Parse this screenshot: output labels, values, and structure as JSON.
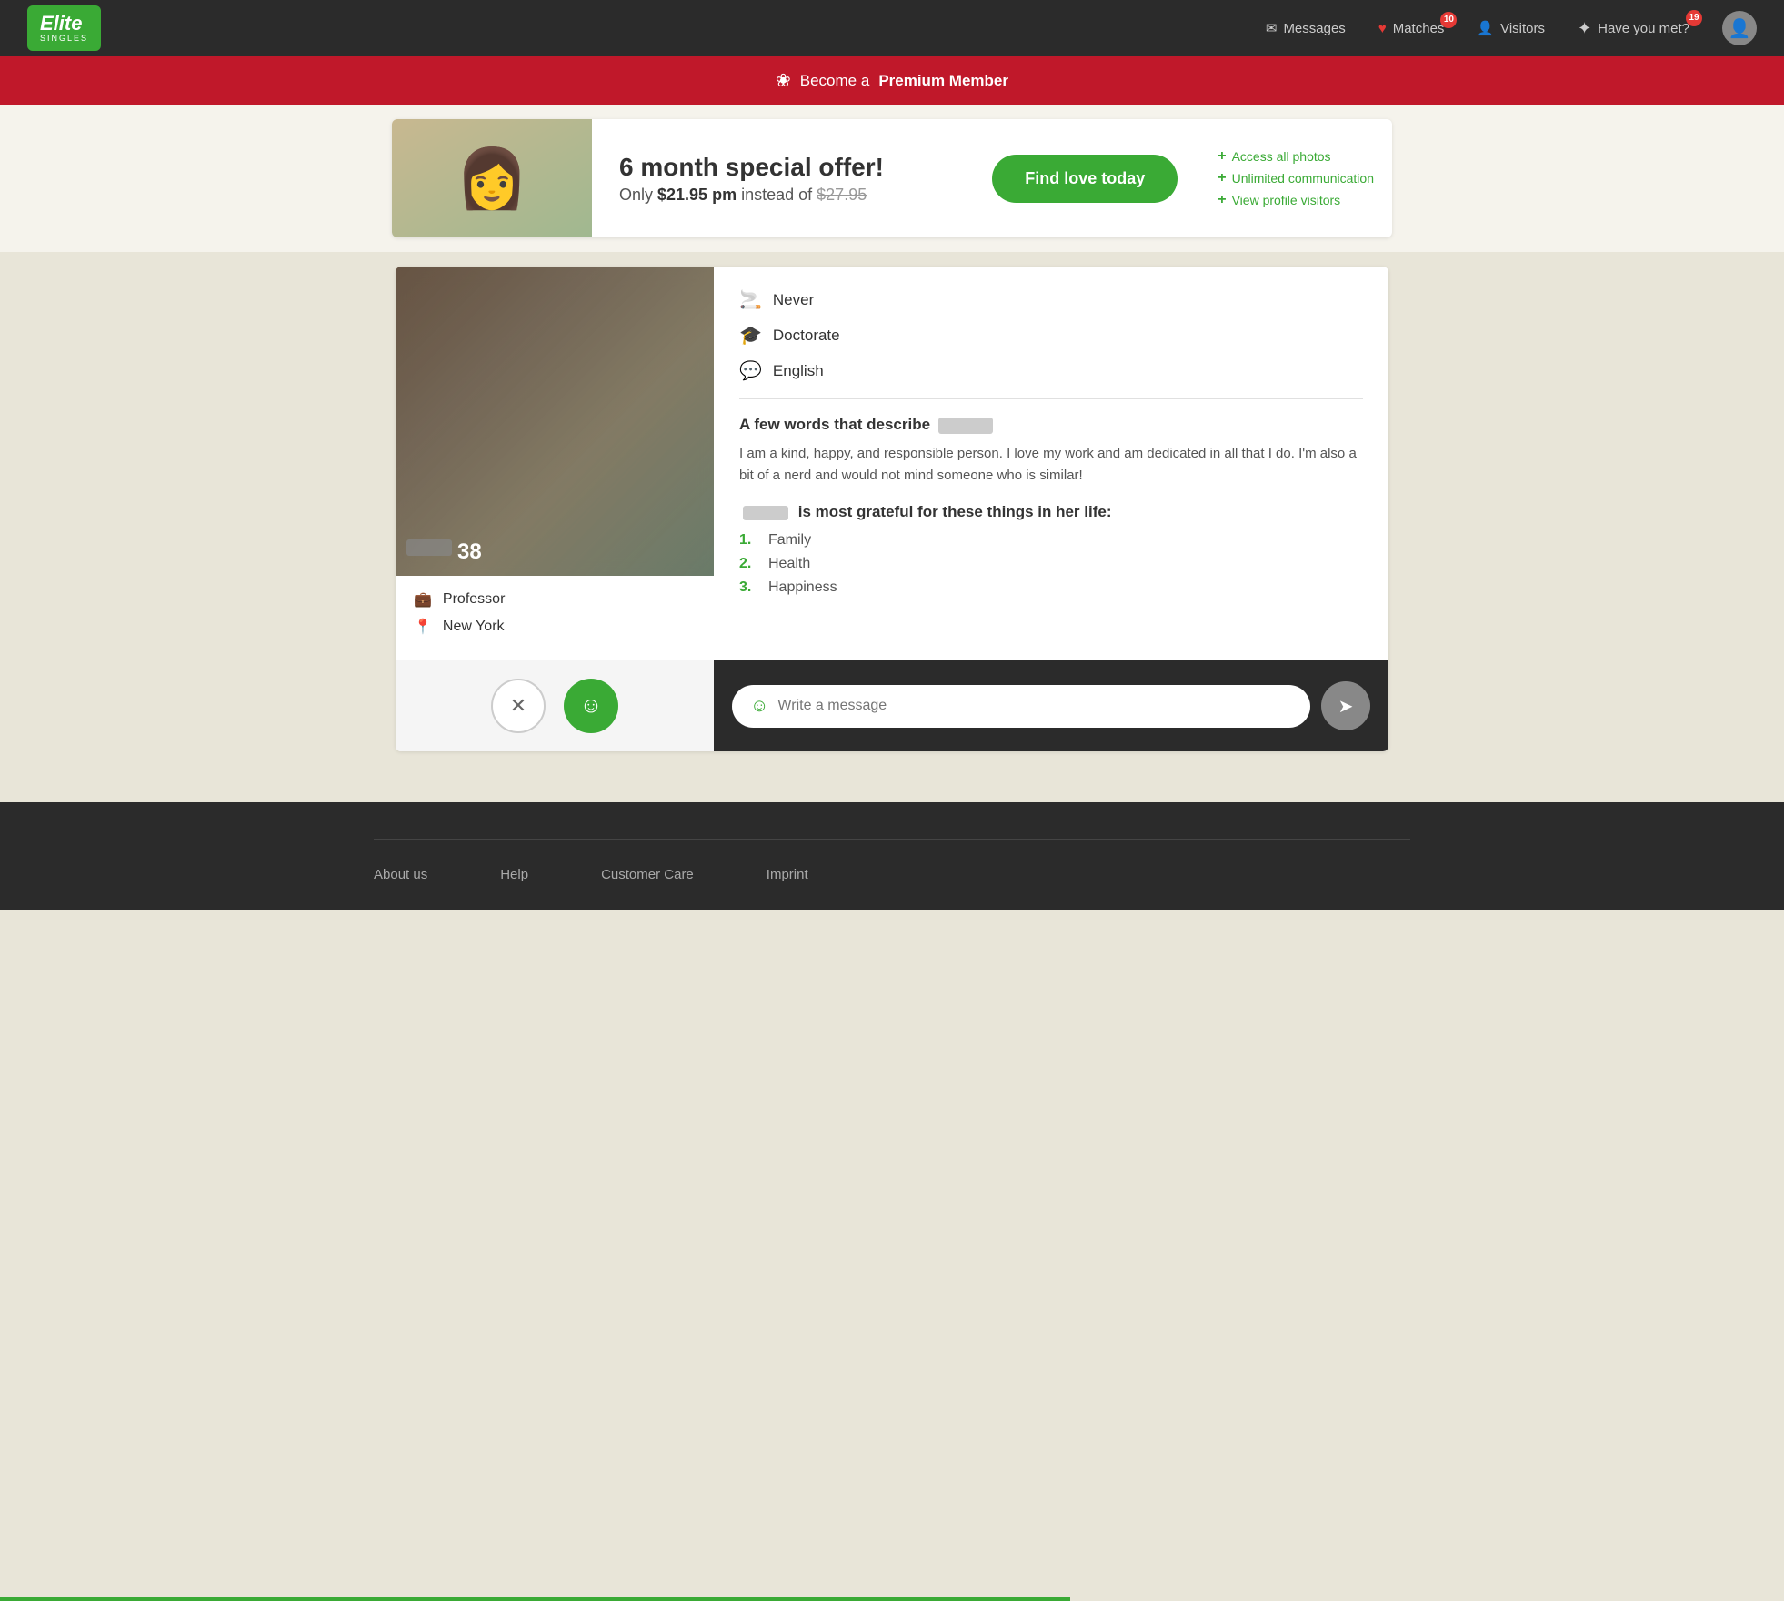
{
  "header": {
    "logo_text": "Elite",
    "logo_sub": "SINGLES",
    "nav": {
      "messages_label": "Messages",
      "matches_label": "Matches",
      "matches_badge": "10",
      "visitors_label": "Visitors",
      "have_you_met_label": "Have you met?",
      "have_you_met_badge": "19"
    }
  },
  "premium_banner": {
    "text_prefix": "Become a ",
    "text_bold": "Premium Member"
  },
  "offer": {
    "title": "6 month special offer!",
    "price_label": "Only ",
    "price_main": "$21.95 pm",
    "price_instead": " instead of ",
    "price_old": "$27.95",
    "cta_label": "Find love today",
    "features": [
      "Access all photos",
      "Unlimited communication",
      "View profile visitors"
    ]
  },
  "profile": {
    "age": "38",
    "name_blur": "",
    "smoking": "Never",
    "education": "Doctorate",
    "language": "English",
    "describe_title": "A few words that describe",
    "describe_text": "I am a kind, happy, and responsible person. I love my work and am dedicated in all that I do. I'm also a bit of a nerd and would not mind someone who is similar!",
    "grateful_title_prefix": "is most grateful for these things in her life:",
    "grateful_items": [
      "Family",
      "Health",
      "Happiness"
    ],
    "occupation": "Professor",
    "location": "New York",
    "message_placeholder": "Write a message"
  },
  "footer": {
    "links": [
      "About us",
      "Help",
      "Customer Care",
      "Imprint"
    ]
  }
}
